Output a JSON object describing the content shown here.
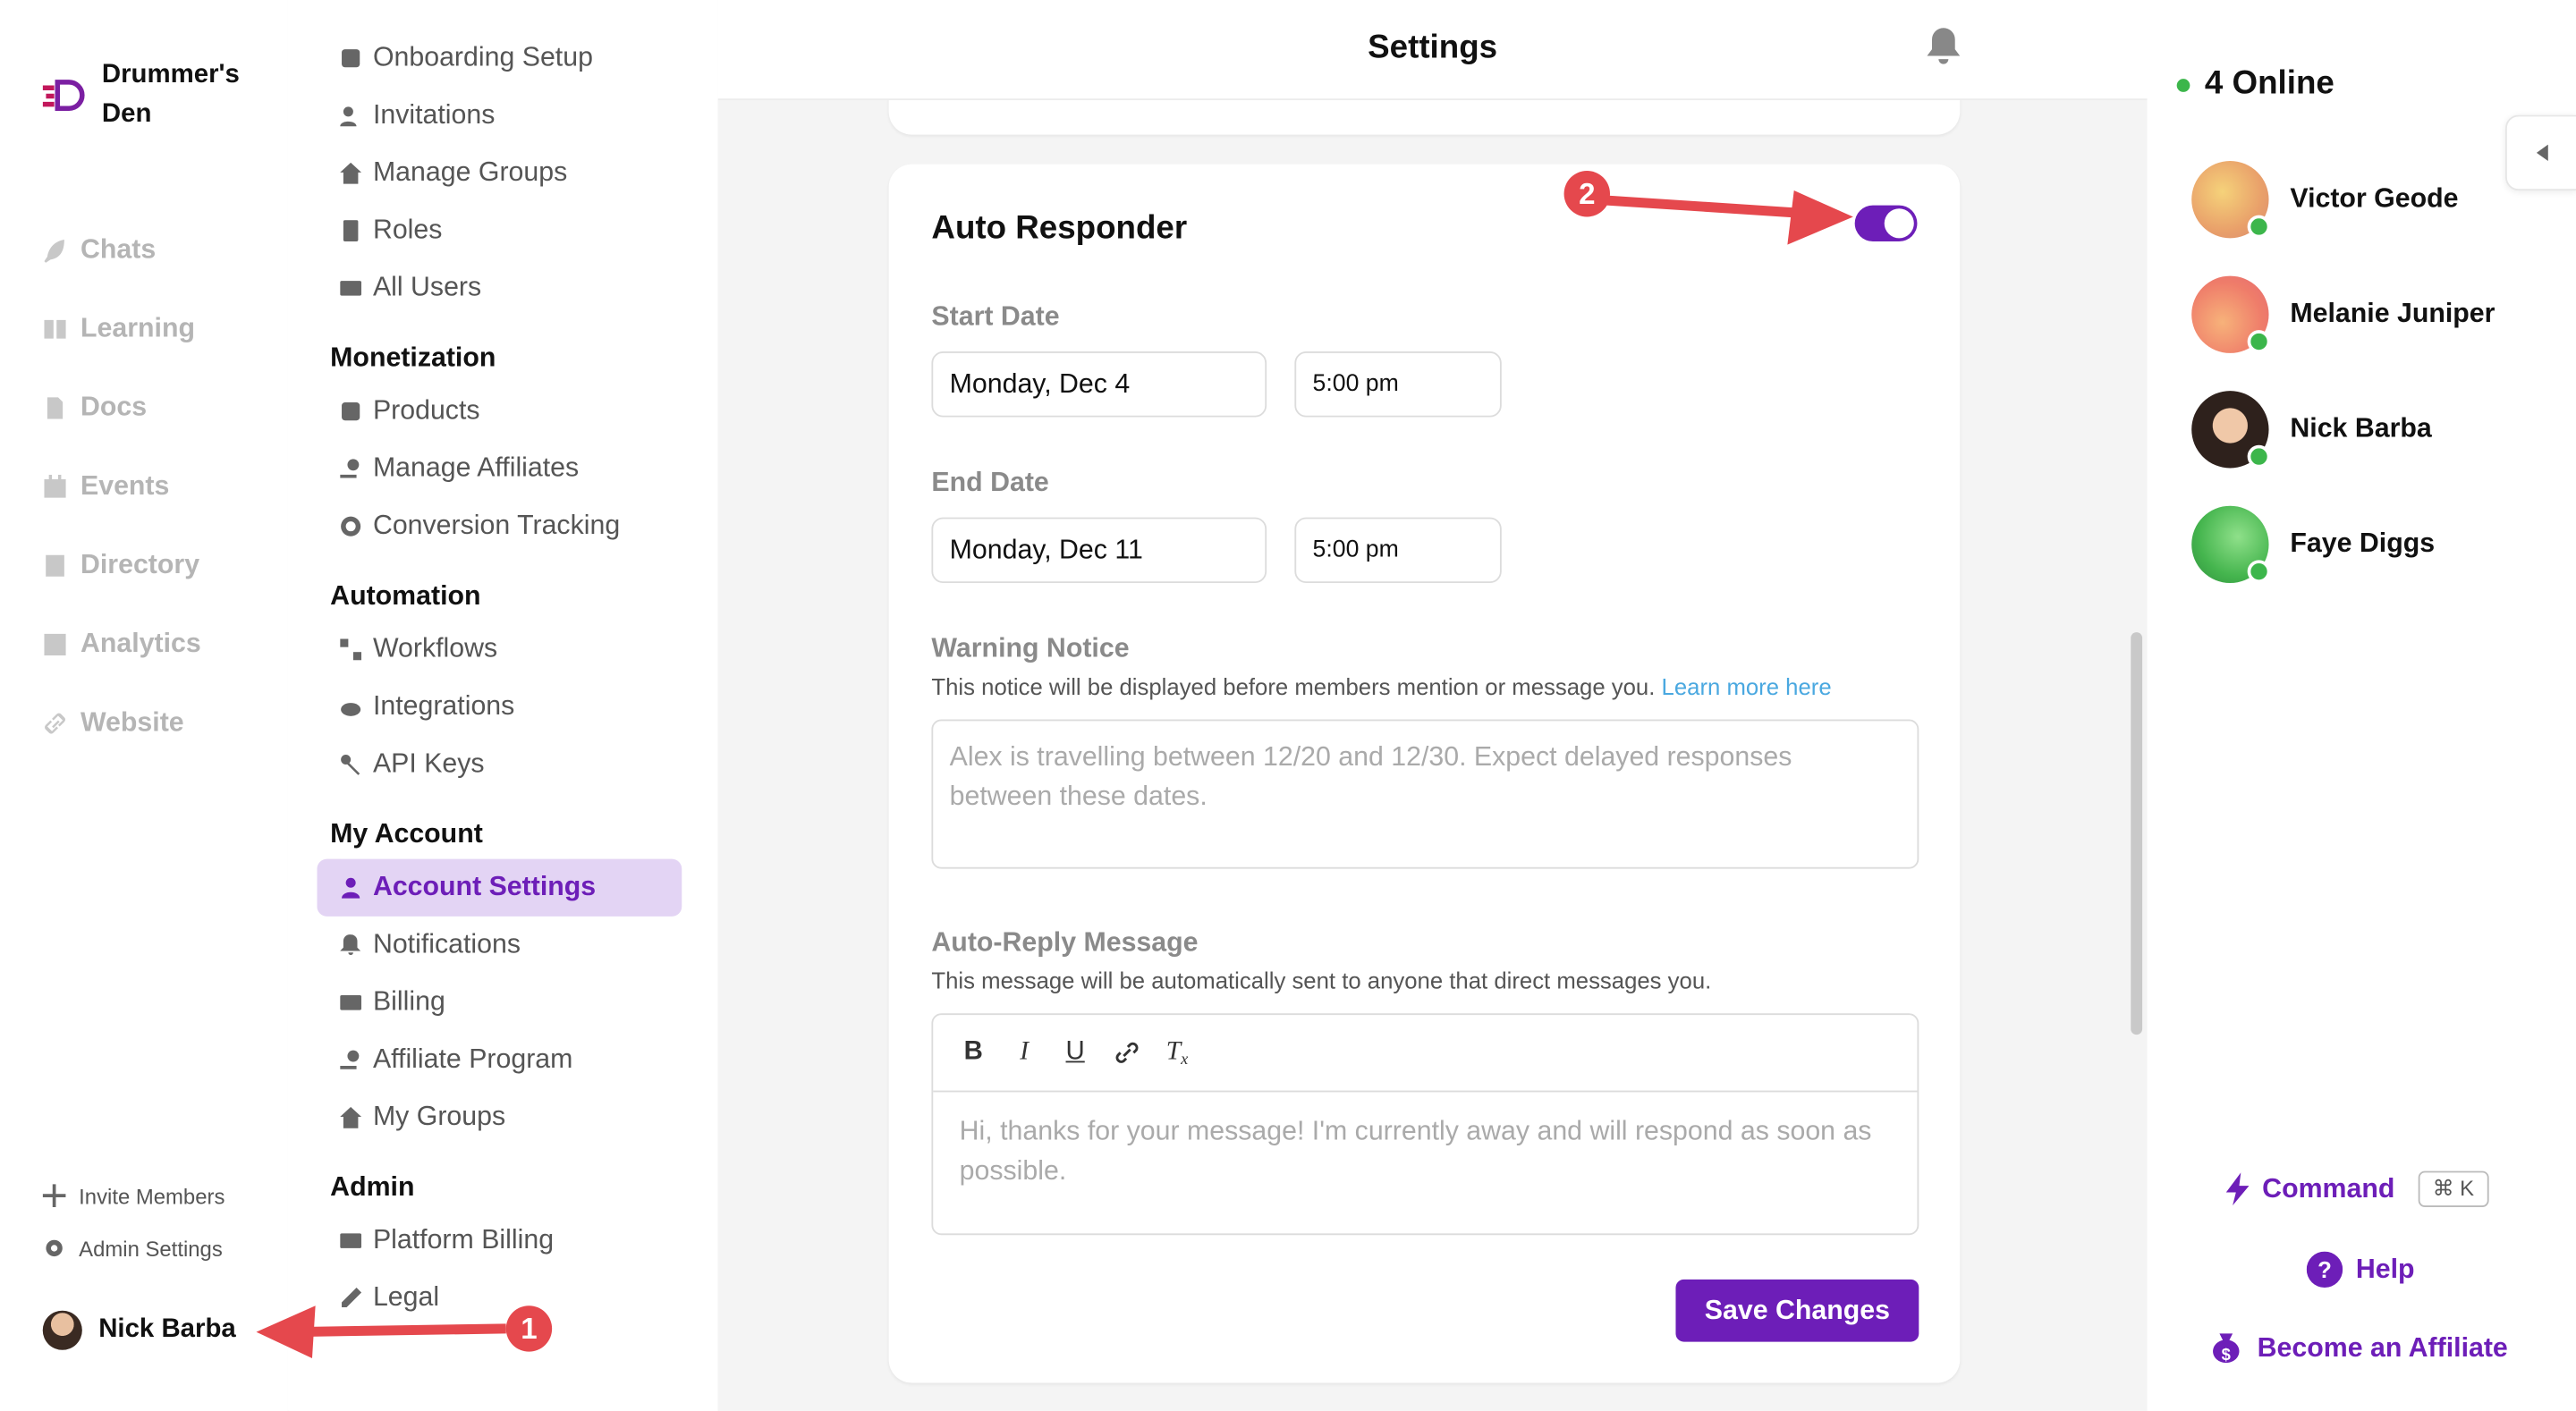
{
  "brand": {
    "name": "Drummer's Den"
  },
  "rail": {
    "items": [
      {
        "label": "Chats",
        "icon": "feather-icon"
      },
      {
        "label": "Learning",
        "icon": "book-icon"
      },
      {
        "label": "Docs",
        "icon": "doc-icon"
      },
      {
        "label": "Events",
        "icon": "calendar-icon"
      },
      {
        "label": "Directory",
        "icon": "contact-icon"
      },
      {
        "label": "Analytics",
        "icon": "chart-icon"
      },
      {
        "label": "Website",
        "icon": "link-icon"
      }
    ],
    "invite": "Invite Members",
    "admin": "Admin Settings",
    "user": "Nick Barba"
  },
  "settings_nav": {
    "top_items": [
      "Onboarding Setup",
      "Invitations",
      "Manage Groups",
      "Roles",
      "All Users"
    ],
    "monetization": {
      "title": "Monetization",
      "items": [
        "Products",
        "Manage Affiliates",
        "Conversion Tracking"
      ]
    },
    "automation": {
      "title": "Automation",
      "items": [
        "Workflows",
        "Integrations",
        "API Keys"
      ]
    },
    "my_account": {
      "title": "My Account",
      "items": [
        "Account Settings",
        "Notifications",
        "Billing",
        "Affiliate Program",
        "My Groups"
      ]
    },
    "admin": {
      "title": "Admin",
      "items": [
        "Platform Billing",
        "Legal"
      ]
    }
  },
  "header": {
    "title": "Settings"
  },
  "auto_responder": {
    "title": "Auto Responder",
    "enabled": true,
    "start_label": "Start Date",
    "start_date": "Monday, Dec 4",
    "start_time": "5:00 pm",
    "end_label": "End Date",
    "end_date": "Monday, Dec 11",
    "end_time": "5:00 pm",
    "warning_label": "Warning Notice",
    "warning_desc": "This notice will be displayed before members mention or message you.",
    "learn_more": "Learn more here",
    "warning_placeholder": "Alex is travelling between 12/20 and 12/30. Expect delayed responses between these dates.",
    "reply_label": "Auto-Reply Message",
    "reply_desc": "This message will be automatically sent to anyone that direct messages you.",
    "reply_placeholder": "Hi, thanks for your message! I'm currently away and will respond as soon as possible.",
    "save": "Save Changes"
  },
  "right_panel": {
    "online": "4 Online",
    "members": [
      "Victor Geode",
      "Melanie Juniper",
      "Nick Barba",
      "Faye Diggs"
    ],
    "command": "Command",
    "shortcut": "⌘ K",
    "help": "Help",
    "affiliate": "Become an Affiliate"
  },
  "annotations": {
    "one": "1",
    "two": "2"
  },
  "colors": {
    "accent": "#6d1eb8",
    "annotation": "#e5484d",
    "online": "#3cb64b"
  }
}
